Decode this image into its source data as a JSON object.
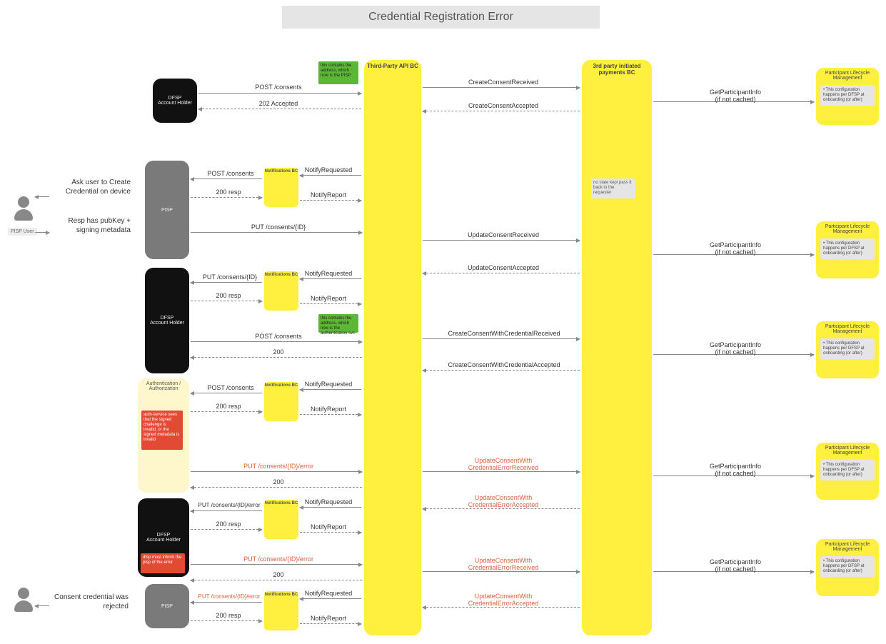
{
  "title": "Credential Registration Error",
  "actors": {
    "pisp_user": "PISP User",
    "dfsp": "DFSP\nAccount Holder",
    "pisp": "PISP",
    "auth": "Authentication /\nAuthorization",
    "lane_third": "Third-Party API BC",
    "lane_pay": "3rd party initiated payments BC",
    "plm": "Participant Lifecycle Management",
    "nbc": "Notifications BC"
  },
  "side": {
    "ask": "Ask user to Create Credential on device",
    "resp": "Resp has pubKey + signing metadata",
    "rejected": "Consent credential was rejected"
  },
  "notes": {
    "green1": "this contains the address, which now is the PISP",
    "green2": "this contains the address, which now is the authentication svc",
    "grey1": "no state kept pass it back to the requester",
    "ltyellow": "auth-service sees that the signed challenge is invalid, or the signed metadata is invalid",
    "red1": "dfsp must inform the pisp of the error"
  },
  "plm_note": "• This configuration happens per DFSP at onboarding (or after)",
  "msgs": {
    "post_consents": "POST /consents",
    "acc202": "202 Accepted",
    "resp200": "200 resp",
    "r200": "200",
    "put_consents": "PUT /consents/{ID}",
    "put_err": "PUT /consents/{ID}/error",
    "nreq": "NotifyRequested",
    "nrep": "NotifyReport",
    "ccr": "CreateConsentReceived",
    "cca": "CreateConsentAccepted",
    "ucr": "UpdateConsentReceived",
    "uca": "UpdateConsentAccepted",
    "ccwcr": "CreateConsentWithCredentialReceived",
    "ccwca": "CreateConsentWithCredentialAccepted",
    "ucwcer1": "UpdateConsentWith",
    "ucwcer2": "CredentialErrorReceived",
    "ucwcea1": "UpdateConsentWith",
    "ucwcea2": "CredentialErrorAccepted",
    "gpi": "GetParticipantInfo",
    "gpi_sub": "(if not cached)"
  }
}
